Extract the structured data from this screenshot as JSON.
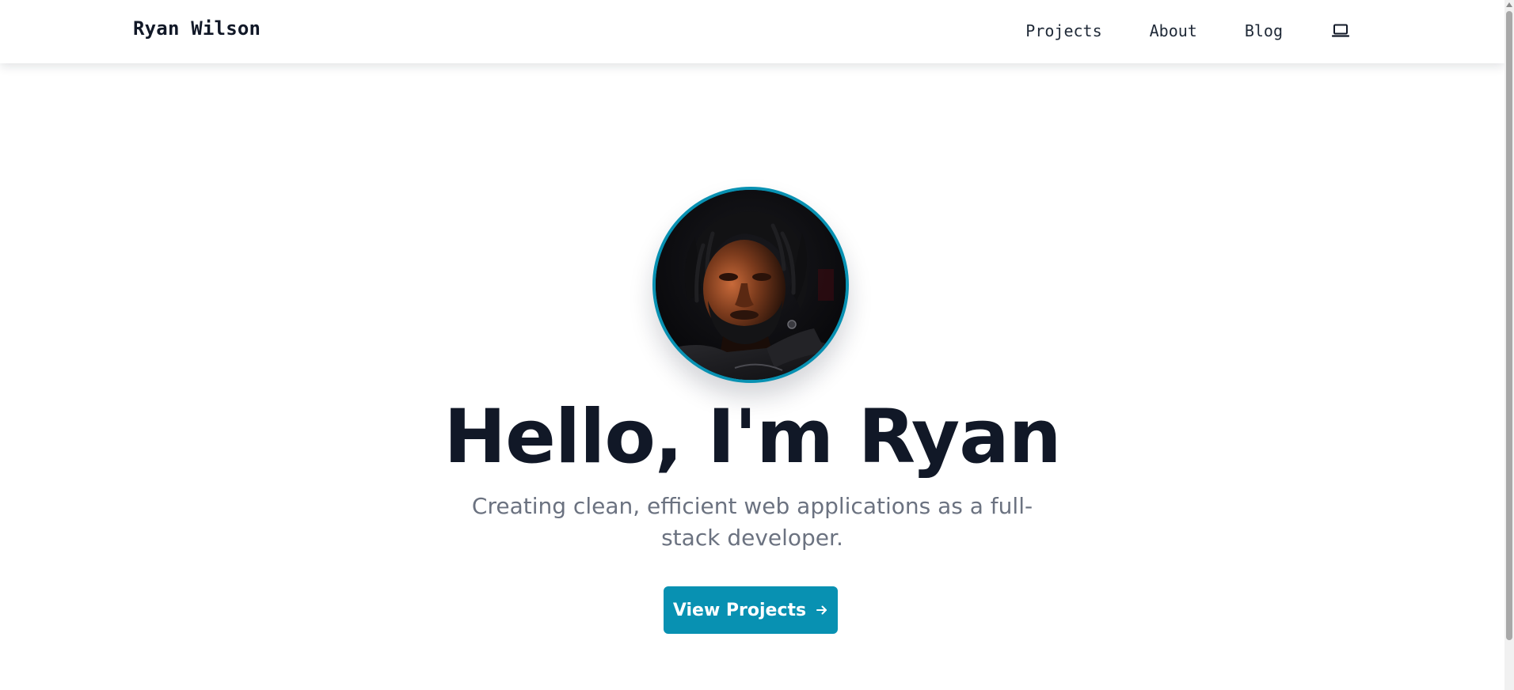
{
  "header": {
    "brand": "Ryan Wilson",
    "nav": [
      {
        "label": "Projects"
      },
      {
        "label": "About"
      },
      {
        "label": "Blog"
      }
    ],
    "theme_toggle_icon": "laptop-icon"
  },
  "hero": {
    "avatar_icon": "profile-photo",
    "title": "Hello, I'm Ryan",
    "subtitle": "Creating clean, efficient web applications as a full-stack developer.",
    "cta_label": "View Projects",
    "cta_icon": "arrow-right-icon"
  },
  "colors": {
    "accent": "#0891b2",
    "heading": "#111827",
    "muted_text": "#6b7280",
    "background": "#ffffff"
  }
}
